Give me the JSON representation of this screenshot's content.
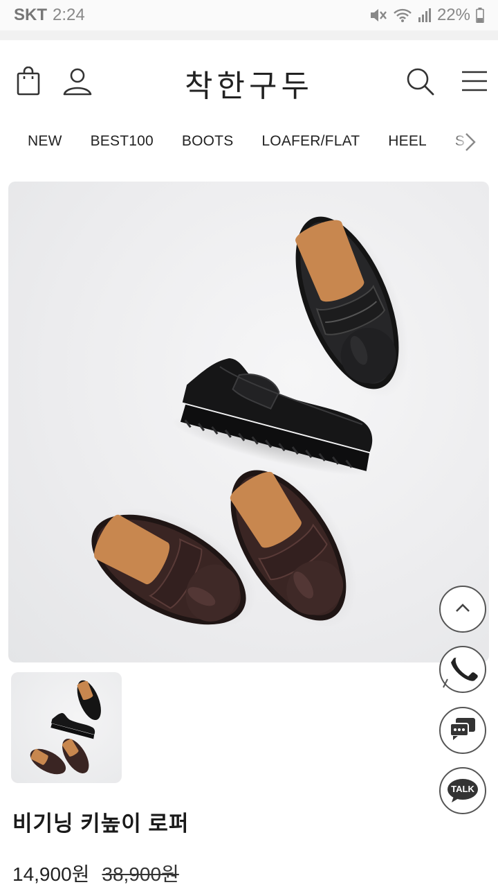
{
  "status_bar": {
    "carrier": "SKT",
    "time": "2:24",
    "battery": "22%",
    "icons": [
      "mute-icon",
      "wifi-icon",
      "signal-icon",
      "battery-icon"
    ]
  },
  "header": {
    "logo": "착한구두",
    "icons": [
      "shopping-bag-icon",
      "user-icon",
      "search-icon",
      "menu-icon"
    ]
  },
  "categories": [
    "NEW",
    "BEST100",
    "BOOTS",
    "LOAFER/FLAT",
    "HEEL",
    "S"
  ],
  "floating_buttons": [
    "scroll-top",
    "phone",
    "chat",
    "kakaotalk"
  ],
  "talk_label": "TALK",
  "product": {
    "title": "비기닝 키높이 로퍼",
    "price": "14,900원",
    "original_price": "38,900원"
  },
  "colors": {
    "shoe_black": "#1b1b1c",
    "shoe_brown": "#3a2523",
    "lining": "#c8874f",
    "background": "#ececee"
  }
}
